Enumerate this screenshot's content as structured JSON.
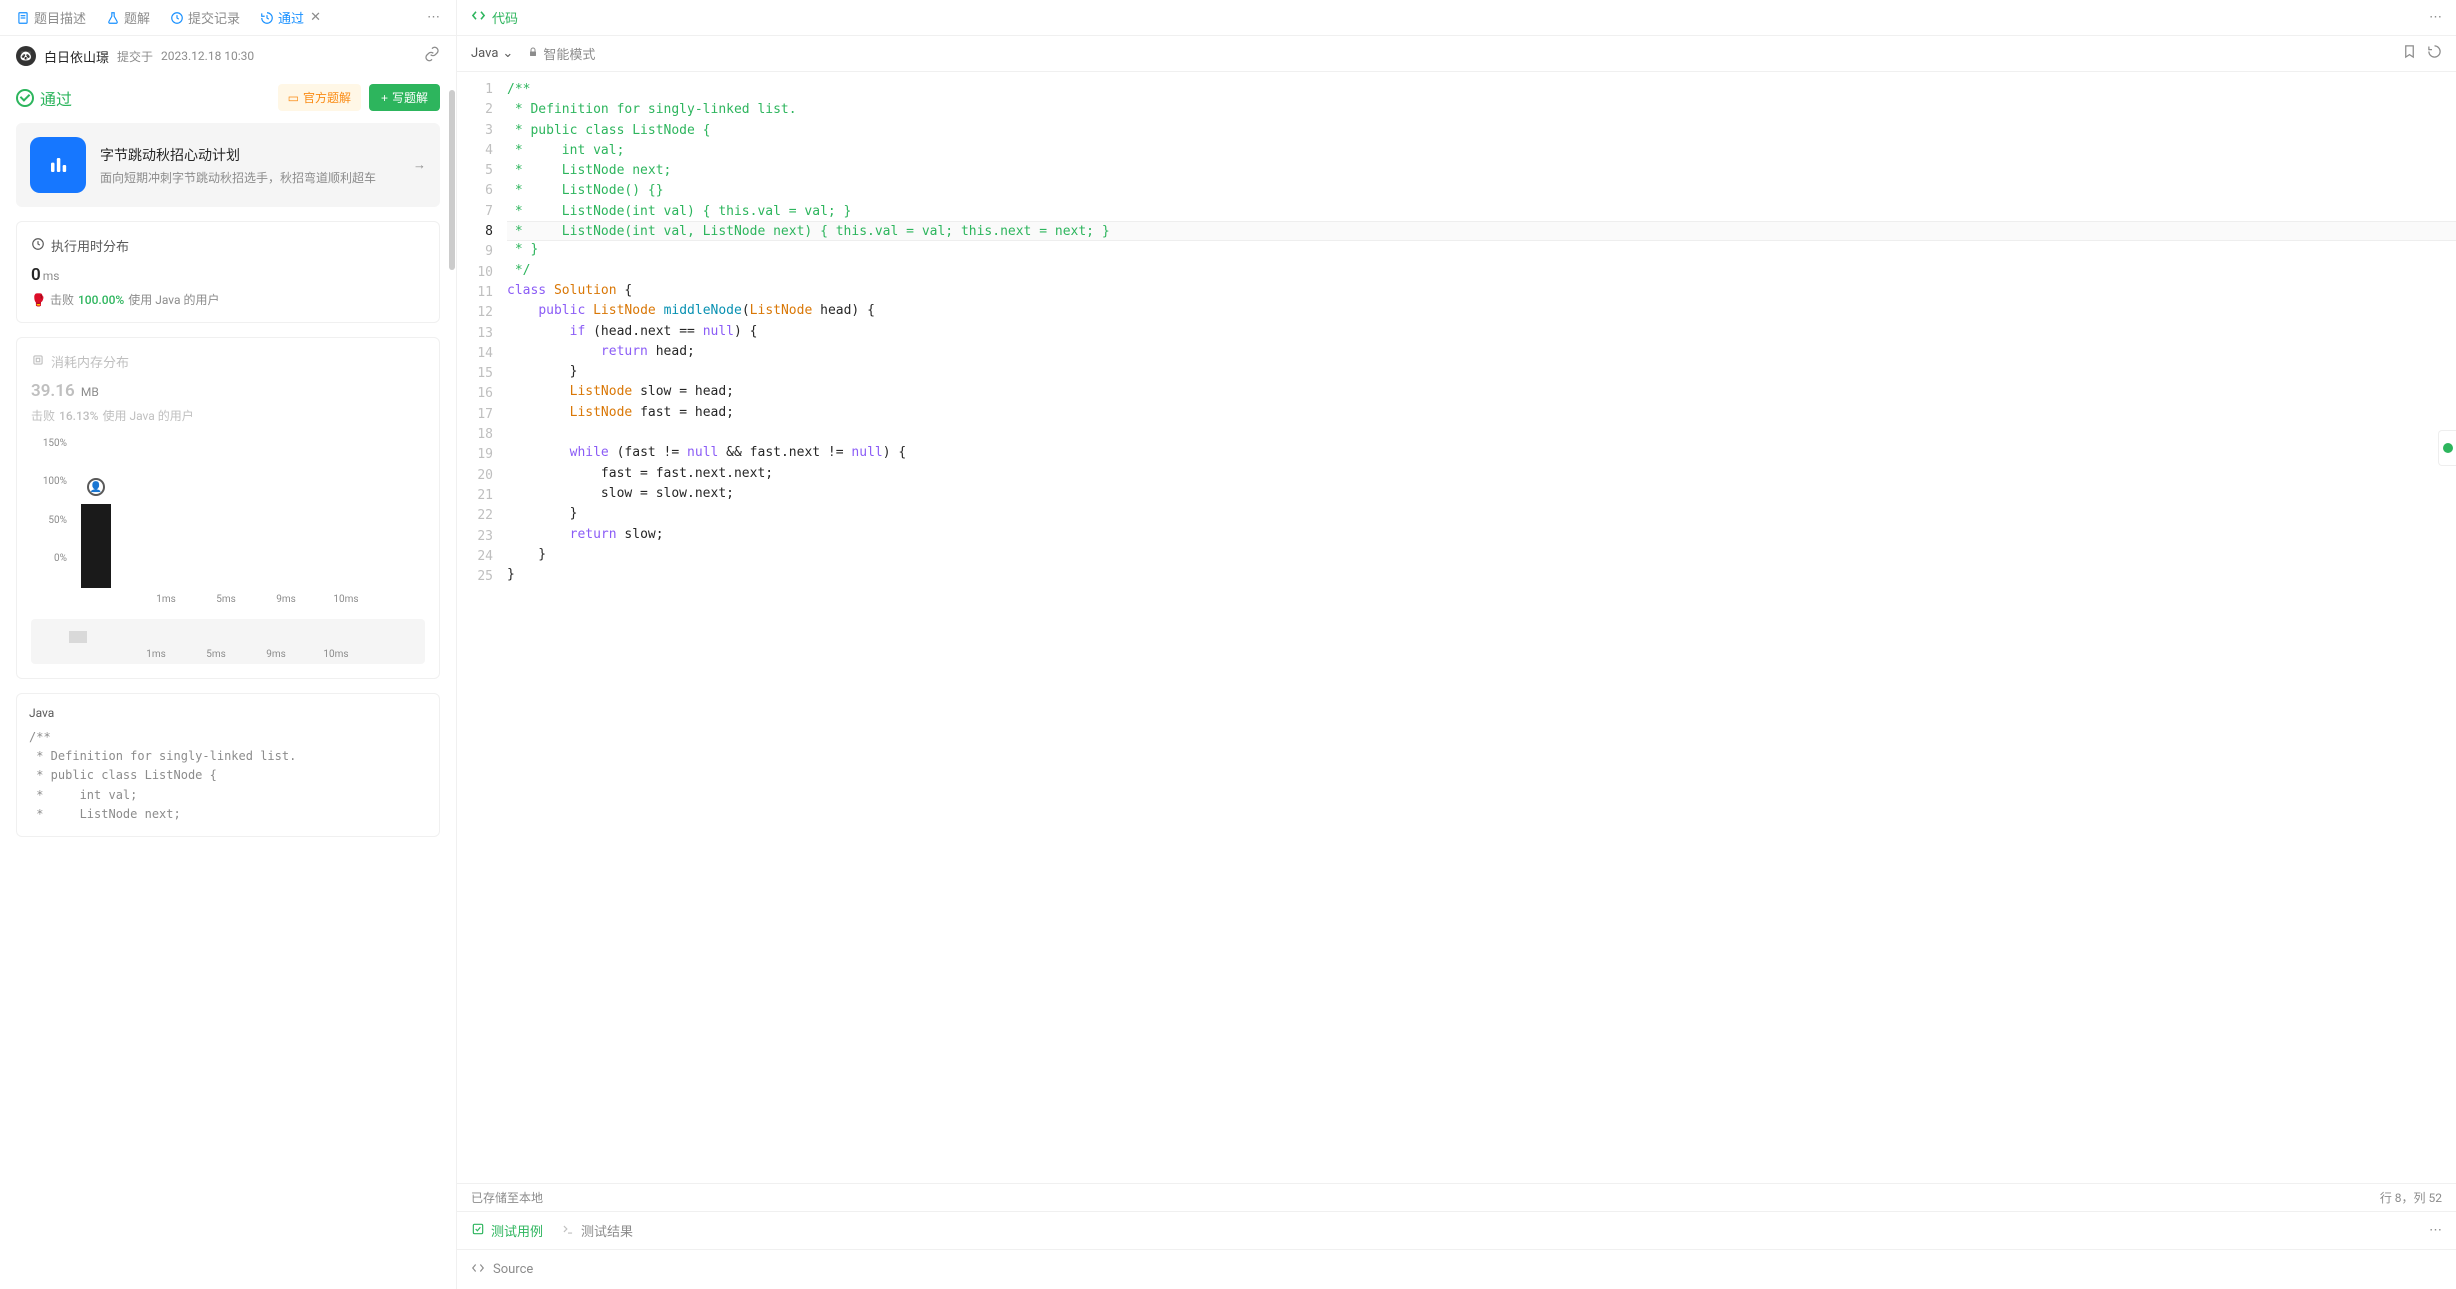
{
  "tabs": {
    "description": "题目描述",
    "solution": "题解",
    "submissions": "提交记录",
    "pass": "通过"
  },
  "submission": {
    "username": "白日依山璟",
    "submit_label": "提交于",
    "timestamp": "2023.12.18 10:30"
  },
  "status": {
    "label": "通过",
    "official_btn": "官方题解",
    "write_btn": "写题解"
  },
  "promo": {
    "title": "字节跳动秋招心动计划",
    "subtitle": "面向短期冲刺字节跳动秋招选手，秋招弯道顺利超车"
  },
  "runtime": {
    "title": "执行用时分布",
    "value": "0",
    "unit": "ms",
    "beat_prefix": "击败",
    "beat_pct": "100.00%",
    "beat_suffix": "使用 Java 的用户"
  },
  "memory": {
    "title": "消耗内存分布",
    "value": "39.16",
    "unit": "MB",
    "beat_prefix": "击败",
    "beat_pct": "16.13%",
    "beat_suffix": "使用 Java 的用户"
  },
  "chart_data": {
    "type": "bar",
    "ylabels": [
      "150%",
      "100%",
      "50%",
      "0%"
    ],
    "xtics": [
      "1ms",
      "5ms",
      "9ms",
      "10ms"
    ],
    "bars": [
      {
        "x": 0,
        "pct": 100
      }
    ],
    "xtics2": [
      "1ms",
      "5ms",
      "9ms",
      "10ms"
    ]
  },
  "code_preview": {
    "lang": "Java",
    "lines": [
      "/**",
      " * Definition for singly-linked list.",
      " * public class ListNode {",
      " *     int val;",
      " *     ListNode next;"
    ]
  },
  "code_header": "代码",
  "lang_selector": "Java",
  "smart_mode": "智能模式",
  "editor_lines": [
    {
      "n": 1,
      "html": "<span class='c-comment'>/**</span>"
    },
    {
      "n": 2,
      "html": "<span class='c-comment'> * Definition for singly-linked list.</span>"
    },
    {
      "n": 3,
      "html": "<span class='c-comment'> * public class ListNode {</span>"
    },
    {
      "n": 4,
      "html": "<span class='c-comment'> *     int val;</span>"
    },
    {
      "n": 5,
      "html": "<span class='c-comment'> *     ListNode next;</span>"
    },
    {
      "n": 6,
      "html": "<span class='c-comment'> *     ListNode() {}</span>"
    },
    {
      "n": 7,
      "html": "<span class='c-comment'> *     ListNode(int val) { this.val = val; }</span>"
    },
    {
      "n": 8,
      "html": "<span class='c-comment'> *     ListNode(int val, ListNode next) { this.val = val; this.next = next; }</span>",
      "current": true
    },
    {
      "n": 9,
      "html": "<span class='c-comment'> * }</span>"
    },
    {
      "n": 10,
      "html": "<span class='c-comment'> */</span>"
    },
    {
      "n": 11,
      "html": "<span class='c-keyword'>class</span> <span class='c-type'>Solution</span> {"
    },
    {
      "n": 12,
      "html": "    <span class='c-keyword'>public</span> <span class='c-type'>ListNode</span> <span class='c-method'>middleNode</span>(<span class='c-type'>ListNode</span> head) {"
    },
    {
      "n": 13,
      "html": "        <span class='c-keyword'>if</span> (head.next == <span class='c-null'>null</span>) {"
    },
    {
      "n": 14,
      "html": "            <span class='c-keyword'>return</span> head;"
    },
    {
      "n": 15,
      "html": "        }"
    },
    {
      "n": 16,
      "html": "        <span class='c-type'>ListNode</span> slow = head;"
    },
    {
      "n": 17,
      "html": "        <span class='c-type'>ListNode</span> fast = head;"
    },
    {
      "n": 18,
      "html": ""
    },
    {
      "n": 19,
      "html": "        <span class='c-keyword'>while</span> (fast != <span class='c-null'>null</span> && fast.next != <span class='c-null'>null</span>) {"
    },
    {
      "n": 20,
      "html": "            fast = fast.next.next;"
    },
    {
      "n": 21,
      "html": "            slow = slow.next;"
    },
    {
      "n": 22,
      "html": "        }"
    },
    {
      "n": 23,
      "html": "        <span class='c-keyword'>return</span> slow;"
    },
    {
      "n": 24,
      "html": "    }"
    },
    {
      "n": 25,
      "html": "}"
    }
  ],
  "save_status": "已存储至本地",
  "cursor": "行 8，列 52",
  "test": {
    "cases": "测试用例",
    "results": "测试结果"
  },
  "source_label": "Source"
}
